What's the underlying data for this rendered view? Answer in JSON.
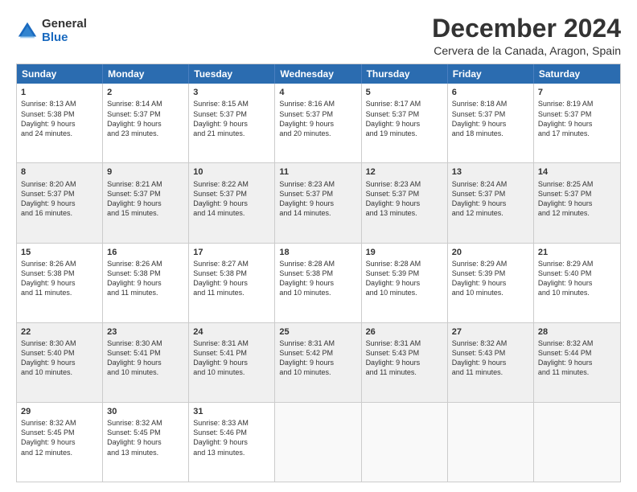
{
  "logo": {
    "general": "General",
    "blue": "Blue"
  },
  "title": "December 2024",
  "subtitle": "Cervera de la Canada, Aragon, Spain",
  "header": {
    "days": [
      "Sunday",
      "Monday",
      "Tuesday",
      "Wednesday",
      "Thursday",
      "Friday",
      "Saturday"
    ]
  },
  "rows": [
    {
      "shaded": false,
      "cells": [
        {
          "day": "1",
          "line1": "Sunrise: 8:13 AM",
          "line2": "Sunset: 5:38 PM",
          "line3": "Daylight: 9 hours",
          "line4": "and 24 minutes."
        },
        {
          "day": "2",
          "line1": "Sunrise: 8:14 AM",
          "line2": "Sunset: 5:37 PM",
          "line3": "Daylight: 9 hours",
          "line4": "and 23 minutes."
        },
        {
          "day": "3",
          "line1": "Sunrise: 8:15 AM",
          "line2": "Sunset: 5:37 PM",
          "line3": "Daylight: 9 hours",
          "line4": "and 21 minutes."
        },
        {
          "day": "4",
          "line1": "Sunrise: 8:16 AM",
          "line2": "Sunset: 5:37 PM",
          "line3": "Daylight: 9 hours",
          "line4": "and 20 minutes."
        },
        {
          "day": "5",
          "line1": "Sunrise: 8:17 AM",
          "line2": "Sunset: 5:37 PM",
          "line3": "Daylight: 9 hours",
          "line4": "and 19 minutes."
        },
        {
          "day": "6",
          "line1": "Sunrise: 8:18 AM",
          "line2": "Sunset: 5:37 PM",
          "line3": "Daylight: 9 hours",
          "line4": "and 18 minutes."
        },
        {
          "day": "7",
          "line1": "Sunrise: 8:19 AM",
          "line2": "Sunset: 5:37 PM",
          "line3": "Daylight: 9 hours",
          "line4": "and 17 minutes."
        }
      ]
    },
    {
      "shaded": true,
      "cells": [
        {
          "day": "8",
          "line1": "Sunrise: 8:20 AM",
          "line2": "Sunset: 5:37 PM",
          "line3": "Daylight: 9 hours",
          "line4": "and 16 minutes."
        },
        {
          "day": "9",
          "line1": "Sunrise: 8:21 AM",
          "line2": "Sunset: 5:37 PM",
          "line3": "Daylight: 9 hours",
          "line4": "and 15 minutes."
        },
        {
          "day": "10",
          "line1": "Sunrise: 8:22 AM",
          "line2": "Sunset: 5:37 PM",
          "line3": "Daylight: 9 hours",
          "line4": "and 14 minutes."
        },
        {
          "day": "11",
          "line1": "Sunrise: 8:23 AM",
          "line2": "Sunset: 5:37 PM",
          "line3": "Daylight: 9 hours",
          "line4": "and 14 minutes."
        },
        {
          "day": "12",
          "line1": "Sunrise: 8:23 AM",
          "line2": "Sunset: 5:37 PM",
          "line3": "Daylight: 9 hours",
          "line4": "and 13 minutes."
        },
        {
          "day": "13",
          "line1": "Sunrise: 8:24 AM",
          "line2": "Sunset: 5:37 PM",
          "line3": "Daylight: 9 hours",
          "line4": "and 12 minutes."
        },
        {
          "day": "14",
          "line1": "Sunrise: 8:25 AM",
          "line2": "Sunset: 5:37 PM",
          "line3": "Daylight: 9 hours",
          "line4": "and 12 minutes."
        }
      ]
    },
    {
      "shaded": false,
      "cells": [
        {
          "day": "15",
          "line1": "Sunrise: 8:26 AM",
          "line2": "Sunset: 5:38 PM",
          "line3": "Daylight: 9 hours",
          "line4": "and 11 minutes."
        },
        {
          "day": "16",
          "line1": "Sunrise: 8:26 AM",
          "line2": "Sunset: 5:38 PM",
          "line3": "Daylight: 9 hours",
          "line4": "and 11 minutes."
        },
        {
          "day": "17",
          "line1": "Sunrise: 8:27 AM",
          "line2": "Sunset: 5:38 PM",
          "line3": "Daylight: 9 hours",
          "line4": "and 11 minutes."
        },
        {
          "day": "18",
          "line1": "Sunrise: 8:28 AM",
          "line2": "Sunset: 5:38 PM",
          "line3": "Daylight: 9 hours",
          "line4": "and 10 minutes."
        },
        {
          "day": "19",
          "line1": "Sunrise: 8:28 AM",
          "line2": "Sunset: 5:39 PM",
          "line3": "Daylight: 9 hours",
          "line4": "and 10 minutes."
        },
        {
          "day": "20",
          "line1": "Sunrise: 8:29 AM",
          "line2": "Sunset: 5:39 PM",
          "line3": "Daylight: 9 hours",
          "line4": "and 10 minutes."
        },
        {
          "day": "21",
          "line1": "Sunrise: 8:29 AM",
          "line2": "Sunset: 5:40 PM",
          "line3": "Daylight: 9 hours",
          "line4": "and 10 minutes."
        }
      ]
    },
    {
      "shaded": true,
      "cells": [
        {
          "day": "22",
          "line1": "Sunrise: 8:30 AM",
          "line2": "Sunset: 5:40 PM",
          "line3": "Daylight: 9 hours",
          "line4": "and 10 minutes."
        },
        {
          "day": "23",
          "line1": "Sunrise: 8:30 AM",
          "line2": "Sunset: 5:41 PM",
          "line3": "Daylight: 9 hours",
          "line4": "and 10 minutes."
        },
        {
          "day": "24",
          "line1": "Sunrise: 8:31 AM",
          "line2": "Sunset: 5:41 PM",
          "line3": "Daylight: 9 hours",
          "line4": "and 10 minutes."
        },
        {
          "day": "25",
          "line1": "Sunrise: 8:31 AM",
          "line2": "Sunset: 5:42 PM",
          "line3": "Daylight: 9 hours",
          "line4": "and 10 minutes."
        },
        {
          "day": "26",
          "line1": "Sunrise: 8:31 AM",
          "line2": "Sunset: 5:43 PM",
          "line3": "Daylight: 9 hours",
          "line4": "and 11 minutes."
        },
        {
          "day": "27",
          "line1": "Sunrise: 8:32 AM",
          "line2": "Sunset: 5:43 PM",
          "line3": "Daylight: 9 hours",
          "line4": "and 11 minutes."
        },
        {
          "day": "28",
          "line1": "Sunrise: 8:32 AM",
          "line2": "Sunset: 5:44 PM",
          "line3": "Daylight: 9 hours",
          "line4": "and 11 minutes."
        }
      ]
    },
    {
      "shaded": false,
      "cells": [
        {
          "day": "29",
          "line1": "Sunrise: 8:32 AM",
          "line2": "Sunset: 5:45 PM",
          "line3": "Daylight: 9 hours",
          "line4": "and 12 minutes."
        },
        {
          "day": "30",
          "line1": "Sunrise: 8:32 AM",
          "line2": "Sunset: 5:45 PM",
          "line3": "Daylight: 9 hours",
          "line4": "and 13 minutes."
        },
        {
          "day": "31",
          "line1": "Sunrise: 8:33 AM",
          "line2": "Sunset: 5:46 PM",
          "line3": "Daylight: 9 hours",
          "line4": "and 13 minutes."
        },
        {
          "day": "",
          "line1": "",
          "line2": "",
          "line3": "",
          "line4": ""
        },
        {
          "day": "",
          "line1": "",
          "line2": "",
          "line3": "",
          "line4": ""
        },
        {
          "day": "",
          "line1": "",
          "line2": "",
          "line3": "",
          "line4": ""
        },
        {
          "day": "",
          "line1": "",
          "line2": "",
          "line3": "",
          "line4": ""
        }
      ]
    }
  ]
}
